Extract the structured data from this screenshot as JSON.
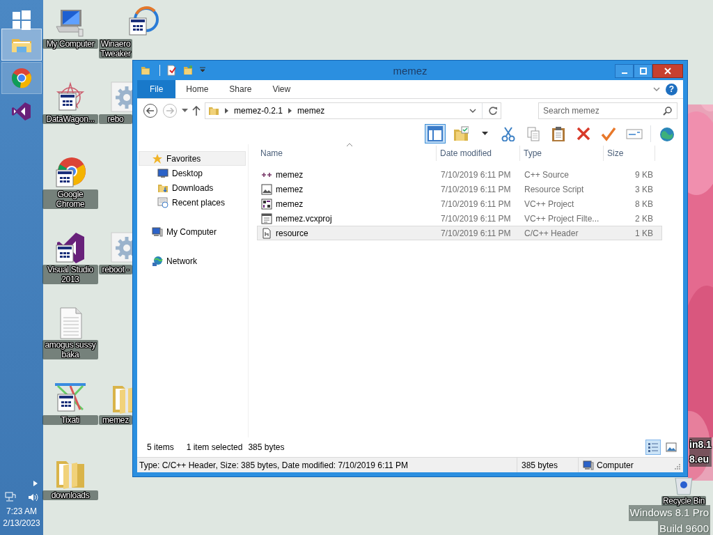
{
  "taskbar": {
    "items": [
      {
        "kind": "start"
      },
      {
        "kind": "explorer",
        "active": true,
        "running": true
      },
      {
        "kind": "chrome",
        "active": false,
        "running": true
      },
      {
        "kind": "visual-studio",
        "active": false,
        "running": false
      }
    ],
    "tray": {
      "time": "7:23 AM",
      "date": "2/13/2023"
    }
  },
  "desktop": {
    "columns": [
      [
        {
          "label": "My Computer",
          "kind": "computer"
        },
        {
          "label": "DataWagon...",
          "kind": "datawagon"
        },
        {
          "label": "Google Chrome",
          "kind": "chrome"
        },
        {
          "label": "Visual Studio 2013",
          "kind": "visual-studio"
        },
        {
          "label": "amogus sussy baka",
          "kind": "text-file"
        },
        {
          "label": "Tixati",
          "kind": "tixati"
        },
        {
          "label": "downloads",
          "kind": "folder"
        }
      ],
      [
        {
          "label": "Winaero Tweaker",
          "kind": "winaero"
        },
        {
          "label": "rebo",
          "kind": "gear"
        },
        null,
        {
          "label": "reboot -",
          "kind": "gear"
        },
        null,
        {
          "label": "memez",
          "kind": "folder"
        },
        null
      ]
    ],
    "partial_label": {
      "lines": [
        "in8.1",
        "8.eu"
      ]
    },
    "recycle_bin": {
      "label": "Recycle Bin"
    },
    "watermark": {
      "edition": "Windows 8.1 Pro",
      "build": "Build 9600"
    }
  },
  "window": {
    "title": "memez",
    "quick_access": [
      {
        "kind": "folder"
      },
      {
        "kind": "properties"
      },
      {
        "kind": "new-folder"
      },
      {
        "kind": "customize"
      }
    ],
    "ribbon": {
      "tabs": [
        {
          "label": "File",
          "kind": "file",
          "selected": false
        },
        {
          "label": "Home",
          "kind": "tab",
          "selected": false
        },
        {
          "label": "Share",
          "kind": "tab",
          "selected": false
        },
        {
          "label": "View",
          "kind": "tab",
          "selected": false
        }
      ],
      "help": "?"
    },
    "address": {
      "segments": [
        "memez-0.2.1",
        "memez"
      ]
    },
    "search": {
      "placeholder": "Search memez"
    },
    "toolbar": {
      "preview_pane": {
        "pressed": true
      },
      "buttons": [
        {
          "kind": "new-folder"
        },
        {
          "kind": "dropdown"
        },
        {
          "kind": "cut"
        },
        {
          "kind": "copy"
        },
        {
          "kind": "paste"
        },
        {
          "kind": "delete"
        },
        {
          "kind": "check"
        },
        {
          "kind": "rename"
        },
        {
          "kind": "separator"
        },
        {
          "kind": "globe"
        }
      ]
    },
    "nav": [
      {
        "label": "Favorites",
        "kind": "star",
        "selected": true,
        "children": [
          {
            "label": "Desktop",
            "kind": "desktop",
            "selected": false
          },
          {
            "label": "Downloads",
            "kind": "downloads",
            "selected": false
          },
          {
            "label": "Recent places",
            "kind": "recent",
            "selected": false
          }
        ]
      },
      {
        "label": "My Computer",
        "kind": "computer",
        "selected": false
      },
      {
        "label": "Network",
        "kind": "network",
        "selected": false
      }
    ],
    "columns": [
      {
        "label": "Name",
        "sorted": true
      },
      {
        "label": "Date modified",
        "sorted": false
      },
      {
        "label": "Type",
        "sorted": false
      },
      {
        "label": "Size",
        "sorted": false
      }
    ],
    "files": [
      {
        "name": "memez",
        "date": "7/10/2019 6:11 PM",
        "type": "C++ Source",
        "size": "9 KB",
        "kind": "cpp",
        "selected": false
      },
      {
        "name": "memez",
        "date": "7/10/2019 6:11 PM",
        "type": "Resource Script",
        "size": "3 KB",
        "kind": "rc",
        "selected": false
      },
      {
        "name": "memez",
        "date": "7/10/2019 6:11 PM",
        "type": "VC++ Project",
        "size": "8 KB",
        "kind": "vcxproj",
        "selected": false
      },
      {
        "name": "memez.vcxproj",
        "date": "7/10/2019 6:11 PM",
        "type": "VC++ Project Filte...",
        "size": "2 KB",
        "kind": "filters",
        "selected": false
      },
      {
        "name": "resource",
        "date": "7/10/2019 6:11 PM",
        "type": "C/C++ Header",
        "size": "1 KB",
        "kind": "header",
        "selected": true
      }
    ],
    "status": {
      "count": "5 items",
      "selection": "1 item selected",
      "selection_size": "385 bytes",
      "views": [
        {
          "kind": "details",
          "selected": true
        },
        {
          "kind": "large-icons",
          "selected": false
        }
      ]
    },
    "details_bar": {
      "info": "Type: C/C++ Header, Size: 385 bytes, Date modified: 7/10/2019 6:11 PM",
      "size": "385 bytes",
      "location": "Computer"
    }
  }
}
